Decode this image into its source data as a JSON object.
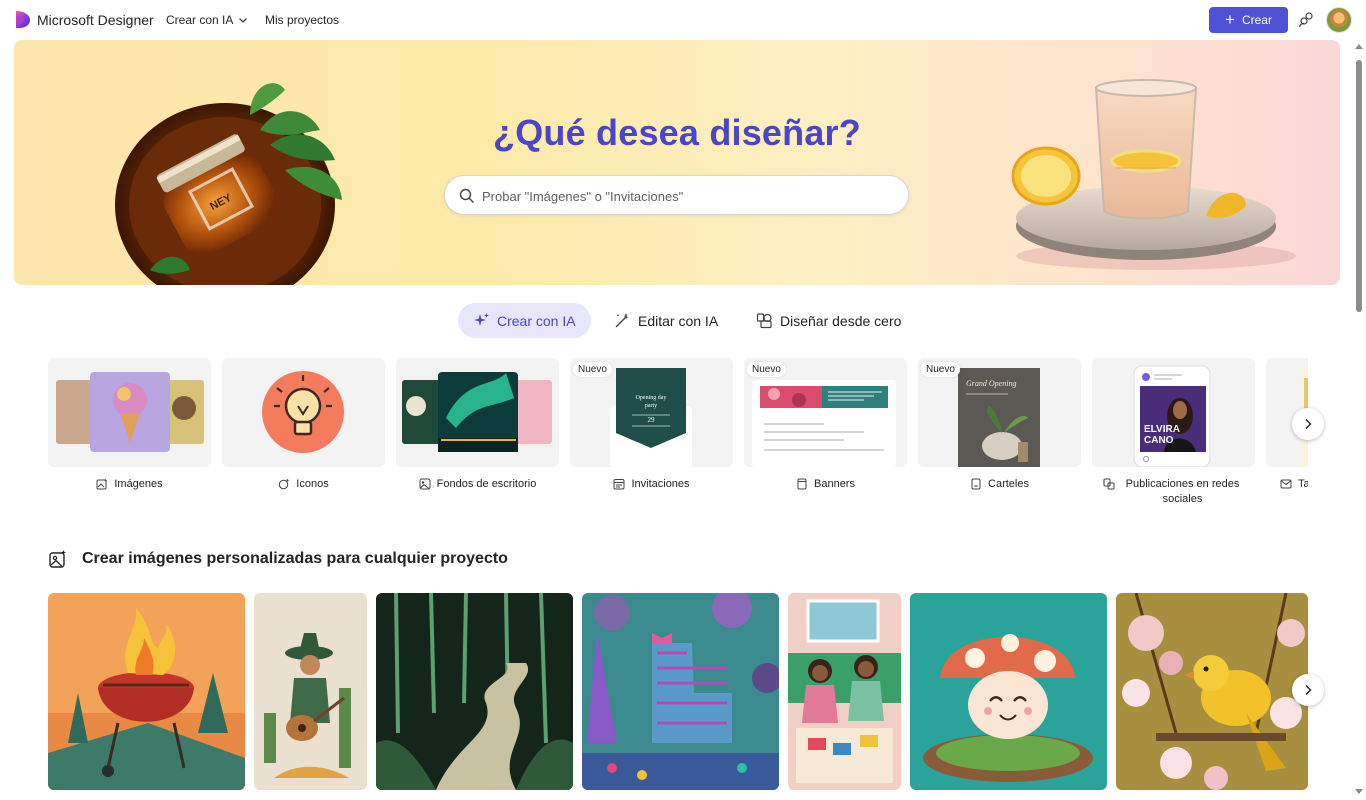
{
  "header": {
    "brand": "Microsoft Designer",
    "nav_create_ai": "Crear con IA",
    "nav_projects": "Mis proyectos",
    "create_button": "Crear"
  },
  "hero": {
    "title": "¿Qué desea diseñar?",
    "search_placeholder": "Probar \"Imágenes\" o \"Invitaciones\""
  },
  "modes": [
    {
      "label": "Crear con IA",
      "icon": "sparkle-icon",
      "active": true
    },
    {
      "label": "Editar con IA",
      "icon": "magic-wand-icon",
      "active": false
    },
    {
      "label": "Diseñar desde cero",
      "icon": "shapes-icon",
      "active": false
    }
  ],
  "categories": [
    {
      "label": "Imágenes",
      "icon": "image-sparkle-icon",
      "badge": ""
    },
    {
      "label": "Iconos",
      "icon": "icon-sparkle-icon",
      "badge": ""
    },
    {
      "label": "Fondos de escritorio",
      "icon": "image-icon",
      "badge": ""
    },
    {
      "label": "Invitaciones",
      "icon": "calendar-icon",
      "badge": "Nuevo",
      "card_text": [
        "Opening day",
        "party",
        "29"
      ]
    },
    {
      "label": "Banners",
      "icon": "document-icon",
      "badge": "Nuevo"
    },
    {
      "label": "Carteles",
      "icon": "poster-icon",
      "badge": "Nuevo",
      "card_text": [
        "Grand Opening"
      ]
    },
    {
      "label": "Publicaciones en redes sociales",
      "icon": "social-post-icon",
      "badge": "",
      "card_text": [
        "ELVIRA",
        "CANO"
      ]
    },
    {
      "label": "Ta",
      "icon": "mail-icon",
      "badge": ""
    }
  ],
  "section": {
    "title": "Crear imágenes personalizadas para cualquier proyecto"
  },
  "gallery": [
    {
      "subject": "grill-flames"
    },
    {
      "subject": "guitar-player-cactus"
    },
    {
      "subject": "forest-path-papercut"
    },
    {
      "subject": "pinata-llama"
    },
    {
      "subject": "kids-reading"
    },
    {
      "subject": "mushroom-character"
    },
    {
      "subject": "yellow-bird-blossoms"
    }
  ],
  "colors": {
    "accent": "#4f52d6",
    "hero_title": "#4a45c9",
    "active_mode_bg": "#e7e6fb"
  }
}
